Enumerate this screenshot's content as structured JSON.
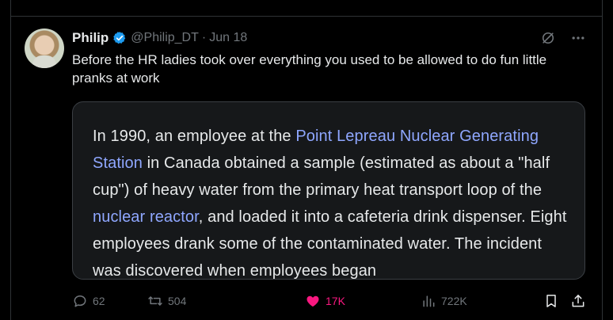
{
  "tweet": {
    "author": {
      "name": "Philip",
      "handle": "@Philip_DT",
      "separator": "·",
      "date": "Jun 18",
      "verified": true
    },
    "text": "Before the HR ladies took over everything you used to be allowed to do fun little pranks at work",
    "quoted_image_text": {
      "segments": [
        {
          "text": "In 1990, an employee at the ",
          "link": false
        },
        {
          "text": "Point Lepreau Nuclear Generating Station",
          "link": true
        },
        {
          "text": " in Canada obtained a sample (estimated as about a \"half cup\") of heavy water from the primary heat transport loop of the ",
          "link": false
        },
        {
          "text": "nuclear reactor",
          "link": true
        },
        {
          "text": ", and loaded it into a cafeteria drink dispenser. Eight employees drank some of the contaminated water. The incident was discovered when employees began",
          "link": false
        }
      ]
    },
    "stats": {
      "replies": "62",
      "reposts": "504",
      "likes": "17K",
      "views": "722K"
    }
  },
  "colors": {
    "background": "#000000",
    "text_primary": "#e7e9ea",
    "text_secondary": "#71767b",
    "like_active": "#f91880",
    "verified_blue": "#1d9bf0",
    "link": "#8fa7ff"
  },
  "icons": {
    "verified": "verified-badge-icon",
    "grok": "grok-icon",
    "more": "more-icon",
    "reply": "reply-icon",
    "repost": "repost-icon",
    "like": "heart-icon",
    "views": "views-icon",
    "bookmark": "bookmark-icon",
    "share": "share-icon"
  }
}
